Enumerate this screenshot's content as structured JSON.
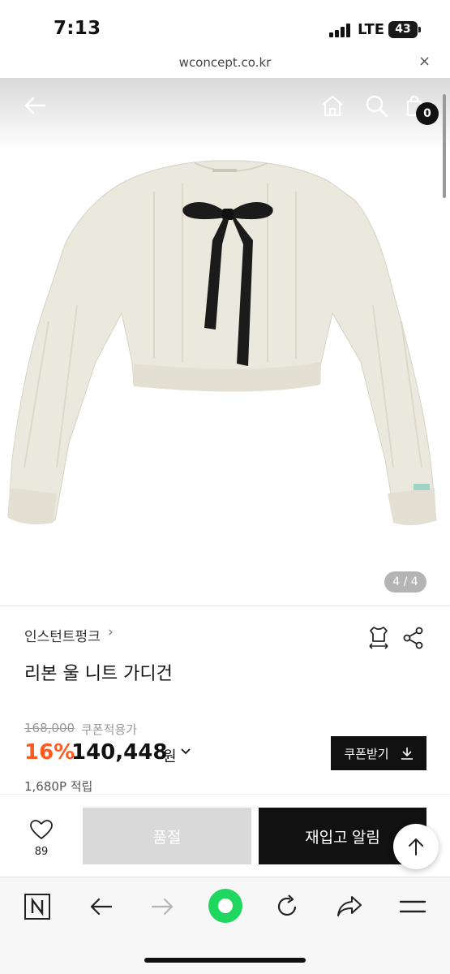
{
  "status_bar": {
    "time": "7:13",
    "network": "LTE",
    "battery": "43"
  },
  "url_bar": {
    "url": "wconcept.co.kr",
    "close": "×"
  },
  "header": {
    "cart_count": "0"
  },
  "gallery": {
    "counter": "4 / 4"
  },
  "product": {
    "brand": "인스턴트펑크",
    "brand_chevron": "›",
    "name": "리본 울 니트 가디건",
    "original_price": "168,000",
    "coupon_label": "쿠폰적용가",
    "discount_rate": "16%",
    "sale_price": "140,448",
    "currency": "원",
    "currency_chevron": "⌄",
    "points": "1,680P 적립",
    "coupon_button": "쿠폰받기"
  },
  "actions": {
    "like_count": "89",
    "soldout_label": "품절",
    "restock_label": "재입고 알림"
  },
  "colors": {
    "accent_discount": "#ff5a1f",
    "primary_button": "#111111",
    "soldout_button": "#d9d9d9"
  },
  "icons": [
    "back-arrow-icon",
    "home-icon",
    "search-icon",
    "cart-icon",
    "size-guide-icon",
    "share-icon",
    "heart-icon",
    "arrow-up-icon",
    "naver-n-icon",
    "nav-back-icon",
    "nav-forward-icon",
    "green-dot-icon",
    "refresh-icon",
    "share-forward-icon",
    "menu-icon",
    "download-icon"
  ]
}
